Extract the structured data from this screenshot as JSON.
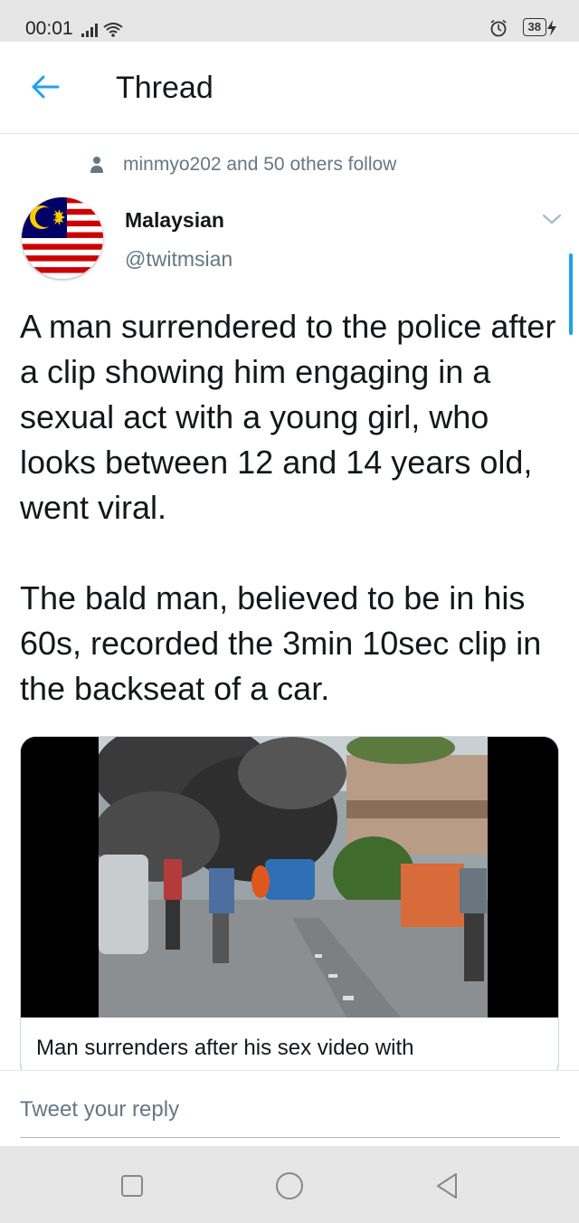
{
  "status_bar": {
    "time": "00:01",
    "battery": "38",
    "icons": [
      "signal-icon",
      "wifi-icon",
      "alarm-icon",
      "battery-icon",
      "charging-icon"
    ]
  },
  "header": {
    "title": "Thread",
    "back_icon": "arrow-left-icon"
  },
  "tweet": {
    "social_context": "minmyo202 and 50 others follow",
    "author_name": "Malaysian",
    "author_handle": "@twitmsian",
    "text_paragraphs": [
      "A man surrendered to the police after a clip showing him engaging in a sexual act with a young girl, who looks between 12 and 14 years old, went viral.",
      "The bald man, believed to be in his 60s, recorded the 3min 10sec clip in the backseat of a car."
    ],
    "card_title": "Man surrenders after his sex video with"
  },
  "reply": {
    "placeholder": "Tweet your reply"
  },
  "nav": {
    "icons": [
      "square-recents-icon",
      "circle-home-icon",
      "triangle-back-icon"
    ]
  },
  "colors": {
    "accent": "#1da1f2",
    "secondary_text": "#657786",
    "primary_text": "#14171a",
    "system_bar": "#e6e6e6"
  }
}
